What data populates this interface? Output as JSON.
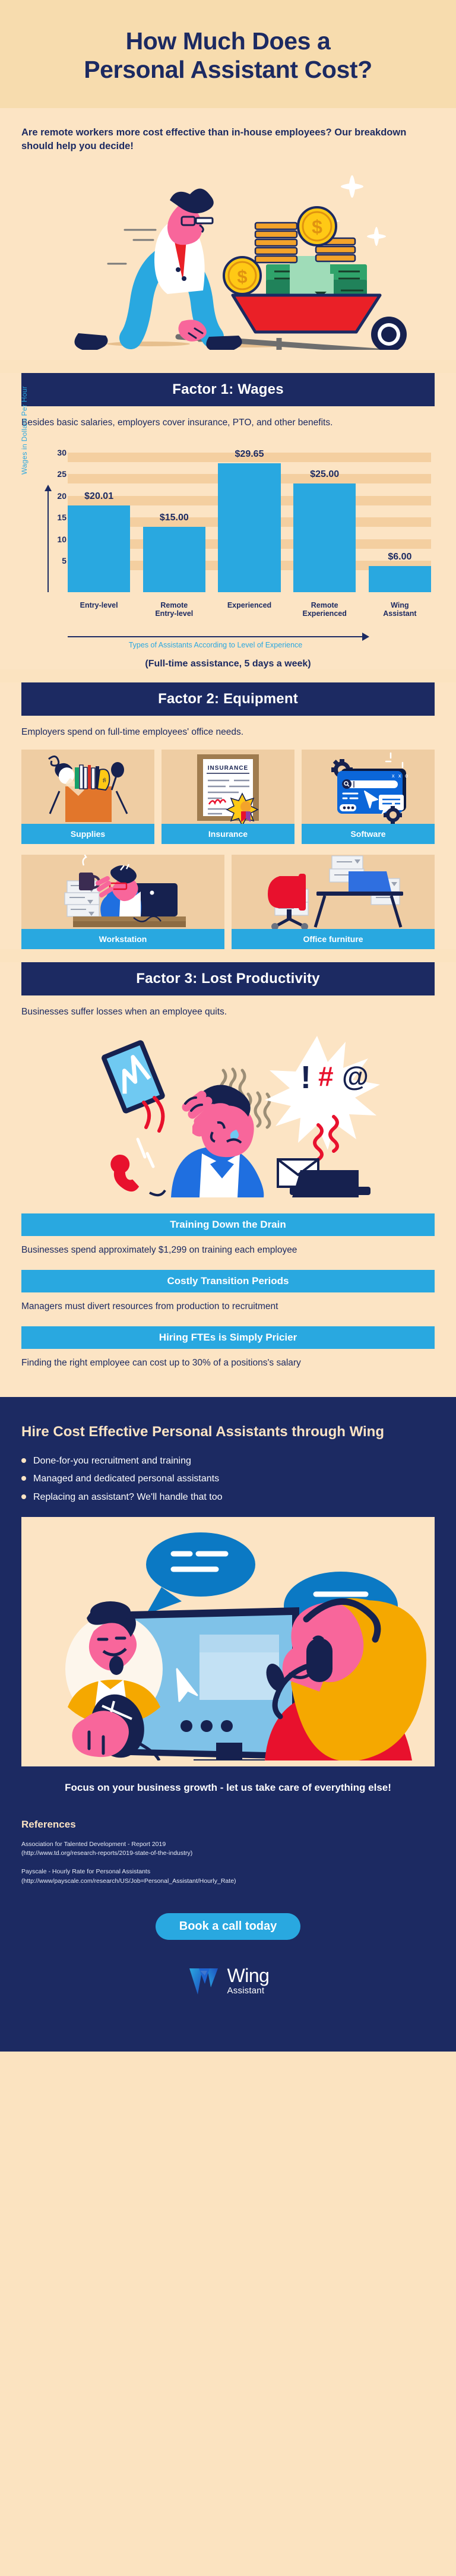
{
  "hero": {
    "title_line1": "How Much Does a",
    "title_line2": "Personal Assistant Cost?",
    "subtitle": "Are remote workers more cost effective than in-house employees? Our breakdown should help you decide!"
  },
  "factor1": {
    "band": "Factor 1: Wages",
    "blurb": "Besides basic salaries, employers cover insurance, PTO, and other benefits.",
    "note": "(Full-time assistance, 5 days a week)"
  },
  "factor2": {
    "band": "Factor 2: Equipment",
    "blurb": "Employers spend on full-time employees' office needs.",
    "cards_row1": [
      {
        "label": "Supplies",
        "icon": "supplies-box-icon"
      },
      {
        "label": "Insurance",
        "icon": "insurance-certificate-icon"
      },
      {
        "label": "Software",
        "icon": "software-window-icon"
      }
    ],
    "cards_row2": [
      {
        "label": "Workstation",
        "icon": "workstation-desk-icon"
      },
      {
        "label": "Office furniture",
        "icon": "office-chair-icon"
      }
    ]
  },
  "factor3": {
    "band": "Factor 3: Lost Productivity",
    "blurb": "Businesses suffer losses when an employee quits.",
    "items": [
      {
        "title": "Training Down the Drain",
        "text": "Businesses spend approximately $1,299 on training each employee"
      },
      {
        "title": "Costly Transition Periods",
        "text": "Managers must divert resources from production to recruitment"
      },
      {
        "title": "Hiring FTEs is Simply Pricier",
        "text": "Finding the right employee can cost up to 30% of a positions's salary"
      }
    ]
  },
  "wing": {
    "heading": "Hire Cost Effective Personal Assistants through Wing",
    "bullets": [
      "Done-for-you recruitment and training",
      "Managed and dedicated personal assistants",
      "Replacing an assistant? We'll handle that too"
    ],
    "cta_text": "Focus on your business growth - let us take care of everything else!",
    "references_heading": "References",
    "references": [
      {
        "title": "Association for Talented Development - Report 2019",
        "url": "(http://www.td.org/research-reports/2019-state-of-the-industry)"
      },
      {
        "title": "Payscale - Hourly Rate for Personal Assistants",
        "url": "(http://www/payscale.com/research/US/Job=Personal_Assistant/Hourly_Rate)"
      }
    ],
    "button_label": "Book a call today",
    "logo_main": "Wing",
    "logo_sub": "Assistant"
  },
  "colors": {
    "navy": "#1c2a62",
    "blue": "#29a8e0",
    "cream": "#fce4c4",
    "cream_dark": "#f7dcae",
    "card_bg": "#efcda3",
    "grid_band": "#f4cfa0"
  },
  "chart_data": {
    "type": "bar",
    "title": "",
    "categories": [
      "Entry-level",
      "Remote Entry-level",
      "Experienced",
      "Remote Experienced",
      "Wing Assistant"
    ],
    "values": [
      20.01,
      15.0,
      29.65,
      25.0,
      6.0
    ],
    "value_labels": [
      "$20.01",
      "$15.00",
      "$29.65",
      "$25.00",
      "$6.00"
    ],
    "ylabel": "Wages in Dollars Per Hour",
    "xlabel": "Types of Assistants According to Level of Experience",
    "yticks": [
      5,
      10,
      15,
      20,
      25,
      30
    ],
    "ylim": [
      0,
      32
    ],
    "grid": true,
    "legend": "none",
    "bar_color": "#29a8e0",
    "note": "(Full-time assistance, 5 days a week)"
  }
}
